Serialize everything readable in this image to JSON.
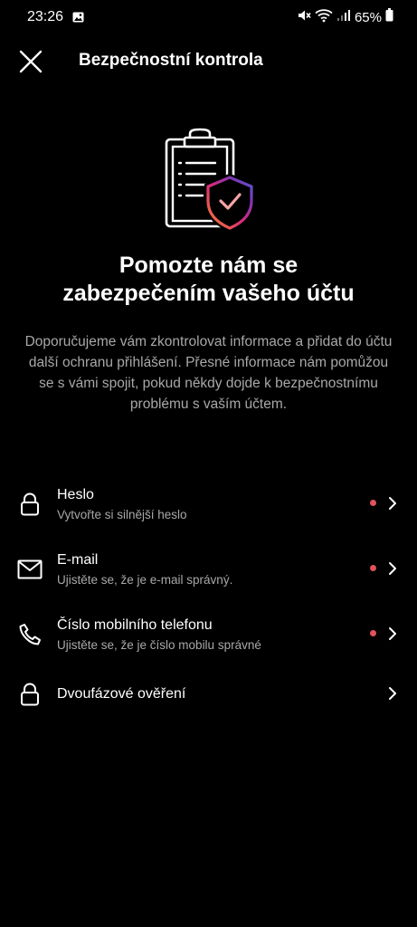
{
  "status_bar": {
    "time": "23:26",
    "battery": "65%",
    "icons": [
      "gallery-icon",
      "mute-icon",
      "wifi-icon",
      "signal-icon",
      "battery-icon"
    ]
  },
  "header": {
    "title": "Bezpečnostní kontrola",
    "close_icon": "close-icon"
  },
  "illustration": {
    "icon": "clipboard-shield-icon",
    "colors": {
      "shield_gradient": [
        "#f58529",
        "#dd2a7b",
        "#8134af",
        "#515bd4"
      ],
      "check": "#f5a5a5"
    }
  },
  "main": {
    "headline_line1": "Pomozte nám se",
    "headline_line2": "zabezpečením vašeho účtu",
    "description": "Doporučujeme vám zkontrolovat informace a přidat do účtu další ochranu přihlášení. Přesné informace nám pomůžou se s vámi spojit, pokud někdy dojde k bezpečnostnímu problému s vaším účtem."
  },
  "items": [
    {
      "icon": "lock-icon",
      "title": "Heslo",
      "subtitle": "Vytvořte si silnější heslo",
      "has_alert": true
    },
    {
      "icon": "mail-icon",
      "title": "E-mail",
      "subtitle": "Ujistěte se, že je e-mail správný.",
      "has_alert": true
    },
    {
      "icon": "phone-icon",
      "title": "Číslo mobilního telefonu",
      "subtitle": "Ujistěte se, že je číslo mobilu správné",
      "has_alert": true
    },
    {
      "icon": "lock-icon",
      "title": "Dvoufázové ověření",
      "subtitle": "",
      "has_alert": false
    }
  ],
  "colors": {
    "background": "#000000",
    "text_primary": "#ffffff",
    "text_secondary": "#a8a8a8",
    "alert_dot": "#e0535b"
  }
}
